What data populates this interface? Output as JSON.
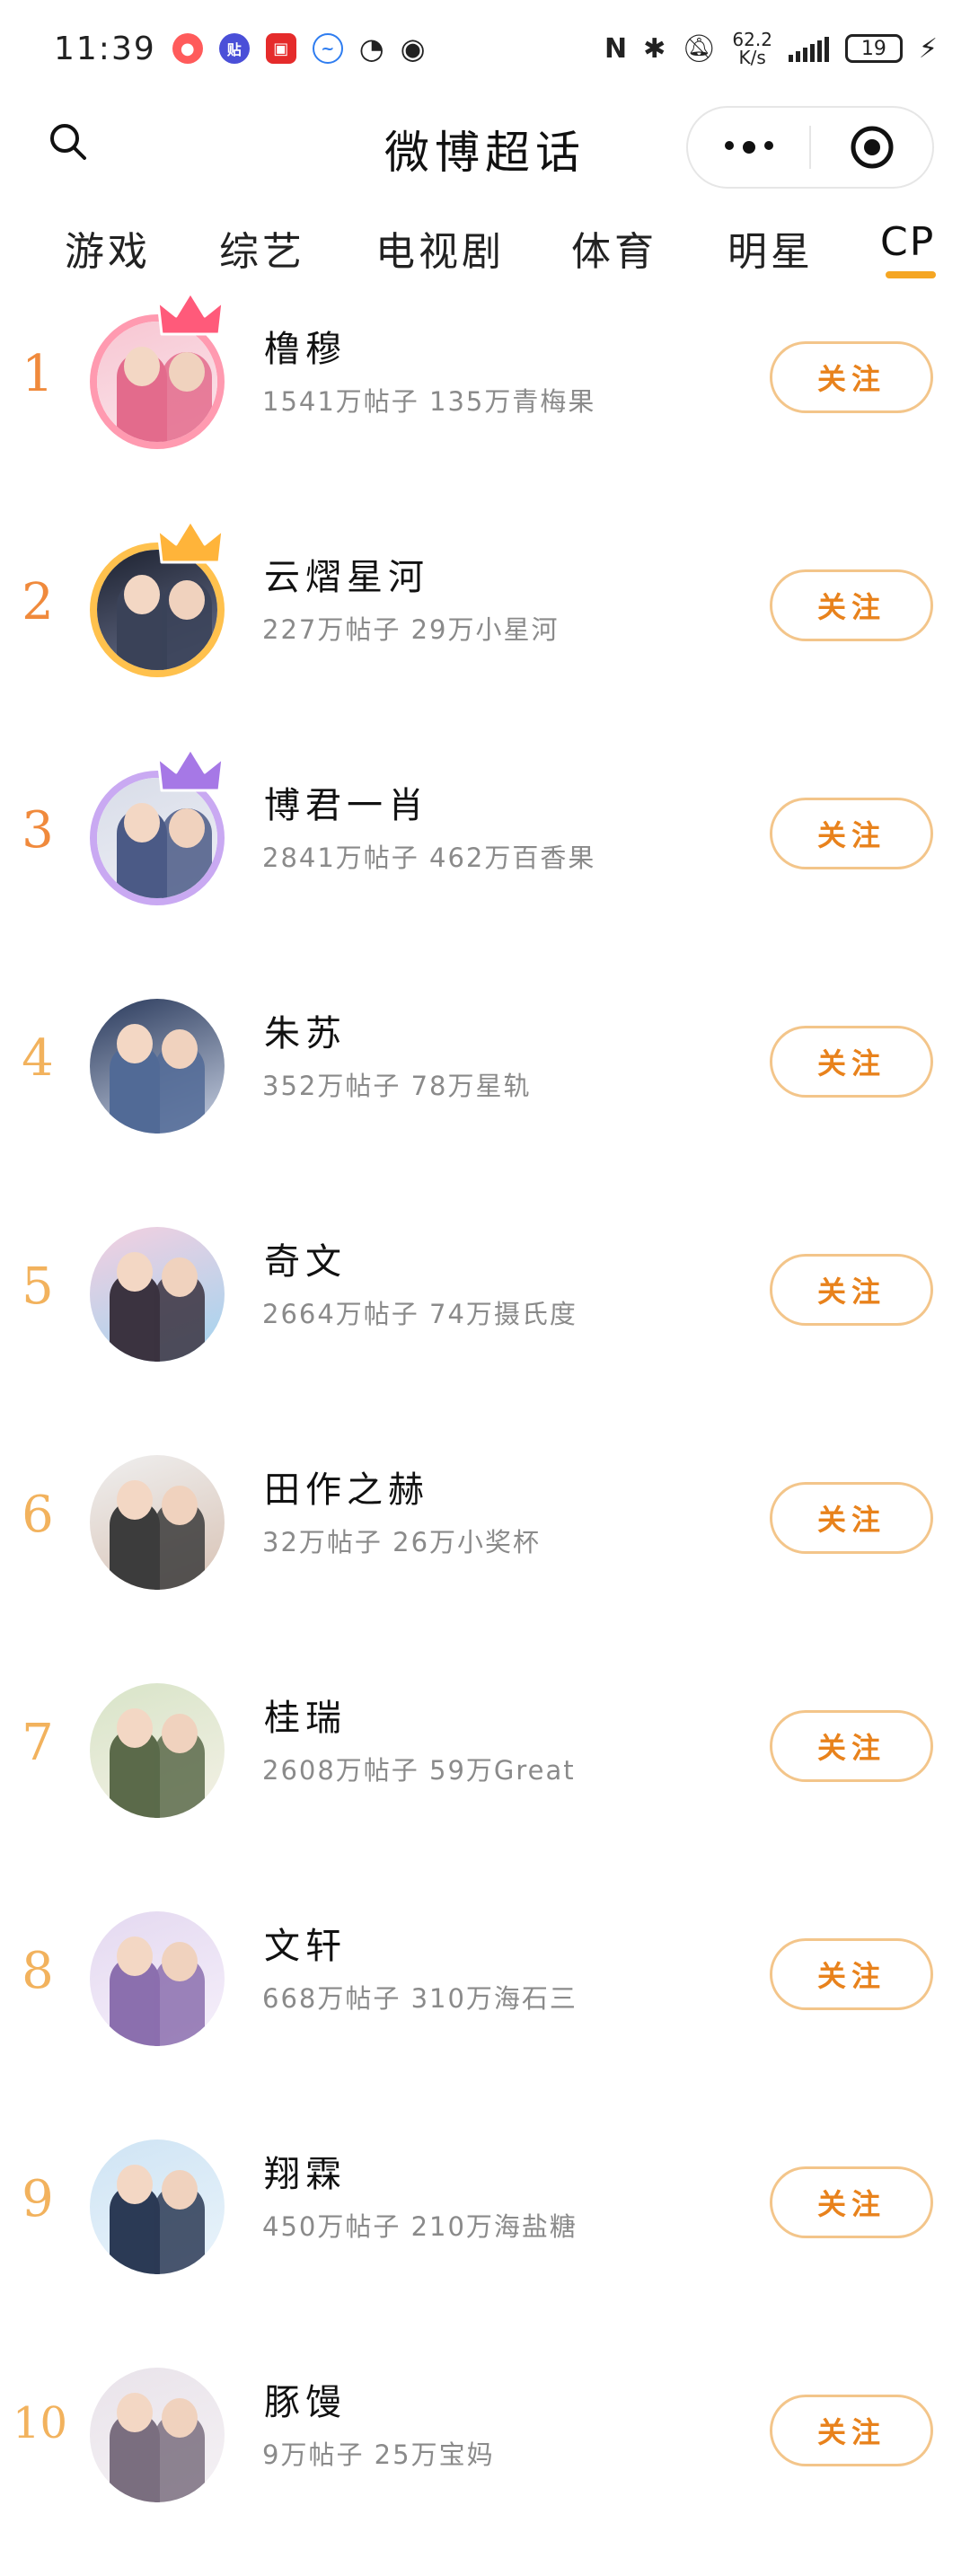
{
  "status_bar": {
    "time": "11:39",
    "app_icon_tie": "贴",
    "net_speed_value": "62.2",
    "net_speed_unit": "K/s",
    "battery": "19"
  },
  "header": {
    "title": "微博超话"
  },
  "tabs": [
    {
      "label": "游戏"
    },
    {
      "label": "综艺"
    },
    {
      "label": "电视剧"
    },
    {
      "label": "体育"
    },
    {
      "label": "明星"
    },
    {
      "label": "CP",
      "active": true
    }
  ],
  "rank_colors": {
    "top": "#f08a3c",
    "rest": "#f2b25d"
  },
  "items": [
    {
      "rank": "1",
      "name": "橹穆",
      "stats": "1541万帖子 135万青梅果",
      "follow": "关注",
      "crown_color": "#ff5a7a",
      "ring_color": "#ff9ab0"
    },
    {
      "rank": "2",
      "name": "云熠星河",
      "stats": "227万帖子 29万小星河",
      "follow": "关注",
      "crown_color": "#ffb43a",
      "ring_color": "#ffc14d"
    },
    {
      "rank": "3",
      "name": "博君一肖",
      "stats": "2841万帖子 462万百香果",
      "follow": "关注",
      "crown_color": "#a678e6",
      "ring_color": "#c9a9f2"
    },
    {
      "rank": "4",
      "name": "朱苏",
      "stats": "352万帖子 78万星轨",
      "follow": "关注"
    },
    {
      "rank": "5",
      "name": "奇文",
      "stats": "2664万帖子 74万摄氏度",
      "follow": "关注"
    },
    {
      "rank": "6",
      "name": "田作之赫",
      "stats": "32万帖子 26万小奖杯",
      "follow": "关注"
    },
    {
      "rank": "7",
      "name": "桂瑞",
      "stats": "2608万帖子 59万Great",
      "follow": "关注"
    },
    {
      "rank": "8",
      "name": "文轩",
      "stats": "668万帖子 310万海石三",
      "follow": "关注"
    },
    {
      "rank": "9",
      "name": "翔霖",
      "stats": "450万帖子 210万海盐糖",
      "follow": "关注"
    },
    {
      "rank": "10",
      "name": "豚馒",
      "stats": "9万帖子 25万宝妈",
      "follow": "关注"
    }
  ]
}
